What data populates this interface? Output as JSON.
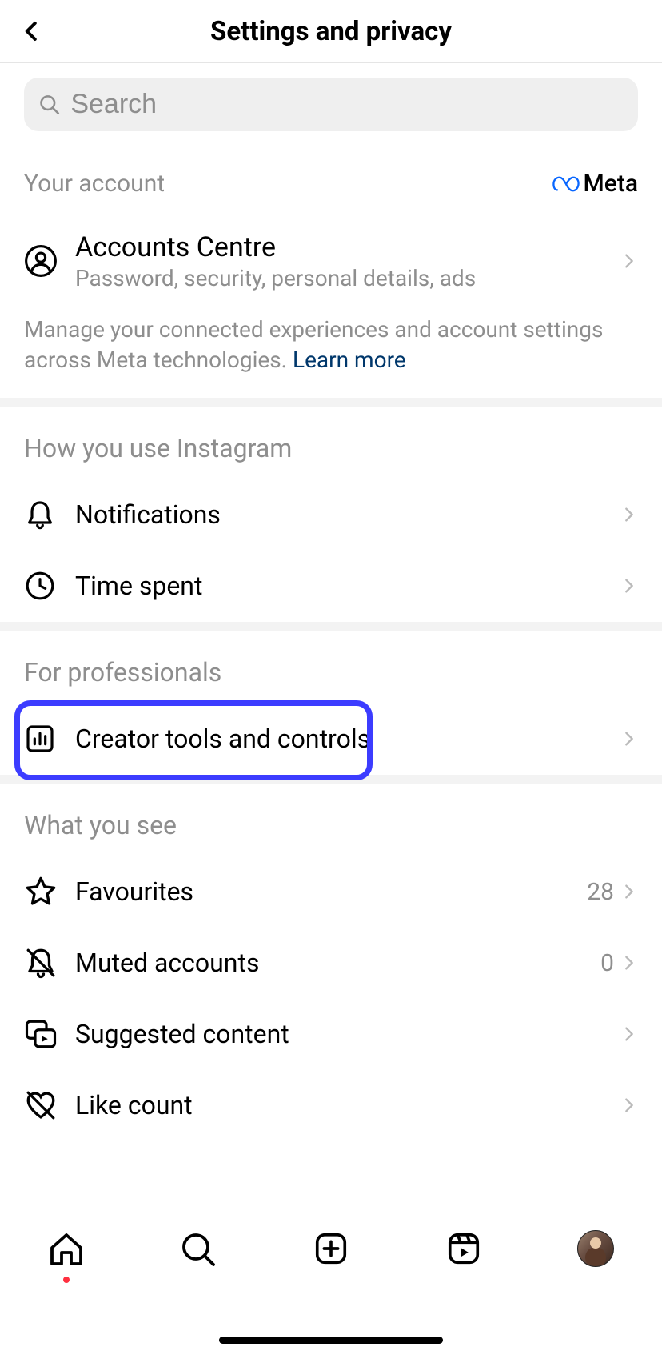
{
  "header": {
    "title": "Settings and privacy"
  },
  "search": {
    "placeholder": "Search"
  },
  "account_section": {
    "title": "Your account",
    "meta_label": "Meta",
    "accounts_centre": {
      "label": "Accounts Centre",
      "sub": "Password, security, personal details, ads"
    },
    "helper": "Manage your connected experiences and account settings across Meta technologies. ",
    "learn_more": "Learn more"
  },
  "use_section": {
    "title": "How you use Instagram",
    "notifications": "Notifications",
    "time_spent": "Time spent"
  },
  "pro_section": {
    "title": "For professionals",
    "creator_tools": "Creator tools and controls"
  },
  "see_section": {
    "title": "What you see",
    "favourites": {
      "label": "Favourites",
      "value": "28"
    },
    "muted": {
      "label": "Muted accounts",
      "value": "0"
    },
    "suggested": "Suggested content",
    "like_count": "Like count"
  }
}
